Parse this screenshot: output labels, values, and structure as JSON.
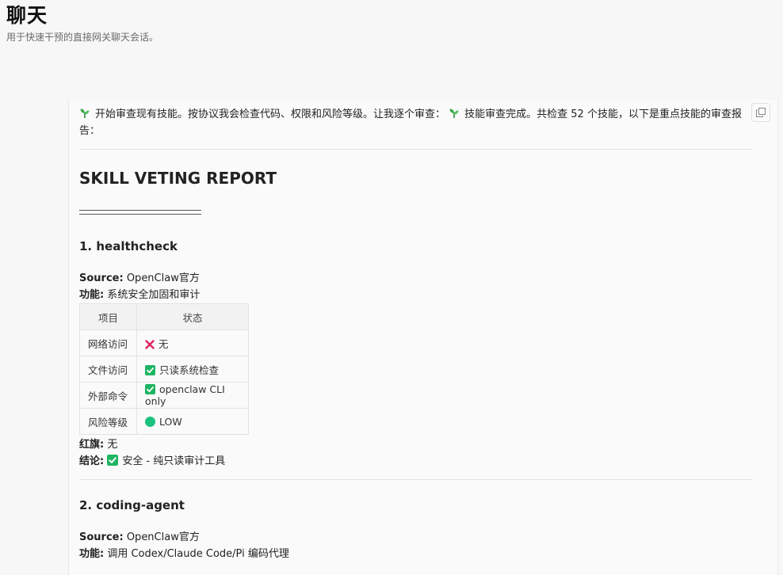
{
  "header": {
    "title": "聊天",
    "subtitle": "用于快速干预的直接网关聊天会话。"
  },
  "message": {
    "intro": "开始审查现有技能。按协议我会检查代码、权限和风险等级。让我逐个审查：",
    "intro_2": "技能审查完成。共检查 52 个技能，以下是重点技能的审查报告：",
    "report_title": "SKILL VETING REPORT",
    "skills": [
      {
        "heading": "1. healthcheck",
        "source_label": "Source:",
        "source_value": "OpenClaw官方",
        "func_label": "功能:",
        "func_value": "系统安全加固和审计",
        "table": {
          "headers": [
            "项目",
            "状态"
          ],
          "rows": [
            {
              "item": "网络访问",
              "status": "无",
              "icon": "cross-icon"
            },
            {
              "item": "文件访问",
              "status": "只读系统检查",
              "icon": "check-icon"
            },
            {
              "item": "外部命令",
              "status": "openclaw CLI only",
              "icon": "check-icon"
            },
            {
              "item": "风险等级",
              "status": "LOW",
              "icon": "green-circle-icon"
            }
          ]
        },
        "red_flag_label": "红旗:",
        "red_flag_value": "无",
        "conclusion_label": "结论:",
        "conclusion_value": "安全 - 纯只读审计工具"
      },
      {
        "heading": "2. coding-agent",
        "source_label": "Source:",
        "source_value": "OpenClaw官方",
        "func_label": "功能:",
        "func_value": "调用 Codex/Claude Code/Pi 编码代理"
      }
    ]
  },
  "colors": {
    "check_green": "#1eb462",
    "cross_red": "#e0245e",
    "circle_green": "#19c37d"
  }
}
